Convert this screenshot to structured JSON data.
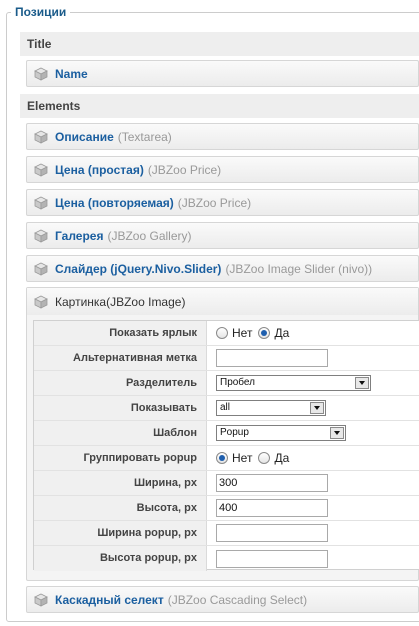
{
  "legend": "Позиции",
  "groups": {
    "title_label": "Title",
    "elements_label": "Elements"
  },
  "title_items": [
    {
      "name": "Name",
      "type": ""
    }
  ],
  "elements": [
    {
      "name": "Описание",
      "type": "(Textarea)"
    },
    {
      "name": "Цена (простая)",
      "type": "(JBZoo Price)"
    },
    {
      "name": "Цена (повторяемая)",
      "type": "(JBZoo Price)"
    },
    {
      "name": "Галерея",
      "type": "(JBZoo Gallery)"
    },
    {
      "name": "Слайдер (jQuery.Nivo.Slider)",
      "type": "(JBZoo Image Slider (nivo))"
    },
    {
      "name": "Картинка",
      "type": "(JBZoo Image)"
    },
    {
      "name": "Каскадный селект",
      "type": "(JBZoo Cascading Select)"
    }
  ],
  "params": {
    "show_label": {
      "label": "Показать ярлык",
      "options": [
        "Нет",
        "Да"
      ],
      "selected": "Да"
    },
    "alt_label": {
      "label": "Альтернативная метка",
      "value": ""
    },
    "separator": {
      "label": "Разделитель",
      "value": "Пробел"
    },
    "display": {
      "label": "Показывать",
      "value": "all"
    },
    "template": {
      "label": "Шаблон",
      "value": "Popup"
    },
    "group_popup": {
      "label": "Группировать popup",
      "options": [
        "Нет",
        "Да"
      ],
      "selected": "Нет"
    },
    "width": {
      "label": "Ширина, px",
      "value": "300"
    },
    "height": {
      "label": "Высота, px",
      "value": "400"
    },
    "popup_width": {
      "label": "Ширина popup, px",
      "value": ""
    },
    "popup_height": {
      "label": "Высота popup, px",
      "value": ""
    }
  },
  "colors": {
    "accent": "#1b5fa0",
    "type_text": "#999999",
    "radio_selected": "#1f5fae"
  },
  "icons": {
    "element": "cube-icon"
  }
}
